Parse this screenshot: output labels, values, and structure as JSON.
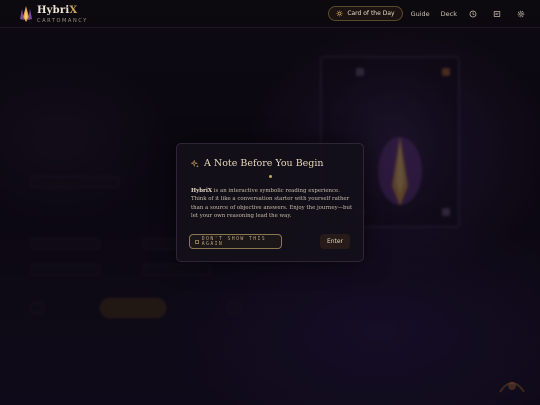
{
  "app": {
    "name_prefix": "Hybri",
    "name_accent": "X",
    "subtitle": "CARTOMANCY"
  },
  "nav": {
    "card_of_the_day": "Card of the Day",
    "guide": "Guide",
    "deck": "Deck",
    "icons": [
      "history-icon",
      "journal-icon",
      "settings-icon"
    ]
  },
  "modal": {
    "title": "A Note Before You Begin",
    "body_brand": "HybriX",
    "body_text": " is an interactive symbolic reading experience. Think of it like a conversation starter with yourself rather than a source of objective answers. Enjoy the journey—but let your own reasoning lead the way.",
    "dont_show_label": "DON'T SHOW THIS AGAIN",
    "enter_label": "Enter"
  },
  "colors": {
    "accent_gold": "#c9a35a",
    "background": "#0d0a12",
    "modal_bg": "#14101a",
    "text_light": "#e8d9bc"
  }
}
